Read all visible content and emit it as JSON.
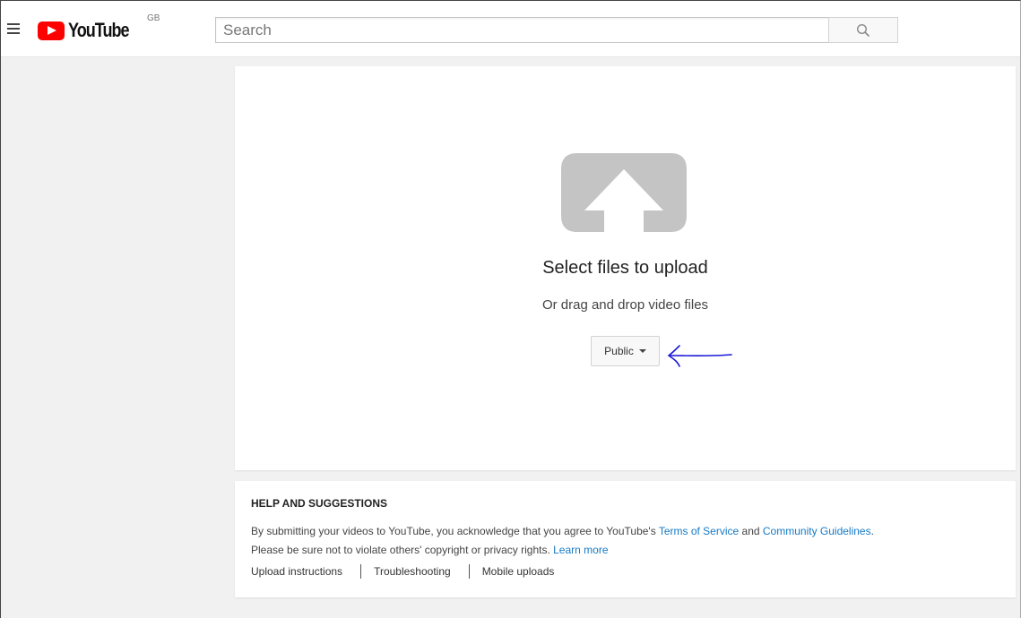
{
  "header": {
    "logo_text": "YouTube",
    "region": "GB",
    "search_placeholder": "Search"
  },
  "upload": {
    "title": "Select files to upload",
    "subtitle": "Or drag and drop video files",
    "privacy_selected": "Public"
  },
  "help": {
    "heading": "HELP AND SUGGESTIONS",
    "line1_prefix": "By submitting your videos to YouTube, you acknowledge that you agree to YouTube's ",
    "terms_link": "Terms of Service",
    "and": " and ",
    "guidelines_link": "Community Guidelines",
    "line1_end": ".",
    "line2_prefix": "Please be sure not to violate others' copyright or privacy rights. ",
    "learn_more": "Learn more",
    "links": [
      "Upload instructions",
      "Troubleshooting",
      "Mobile uploads"
    ]
  },
  "colors": {
    "brand_red": "#ff0000",
    "link_blue": "#167ac6",
    "annotation_blue": "#1a1ad6",
    "upload_icon_gray": "#c4c4c4"
  },
  "icons": {
    "menu": "hamburger-menu-icon",
    "search": "search-icon",
    "upload": "upload-arrow-icon",
    "dropdown": "caret-down-icon"
  }
}
